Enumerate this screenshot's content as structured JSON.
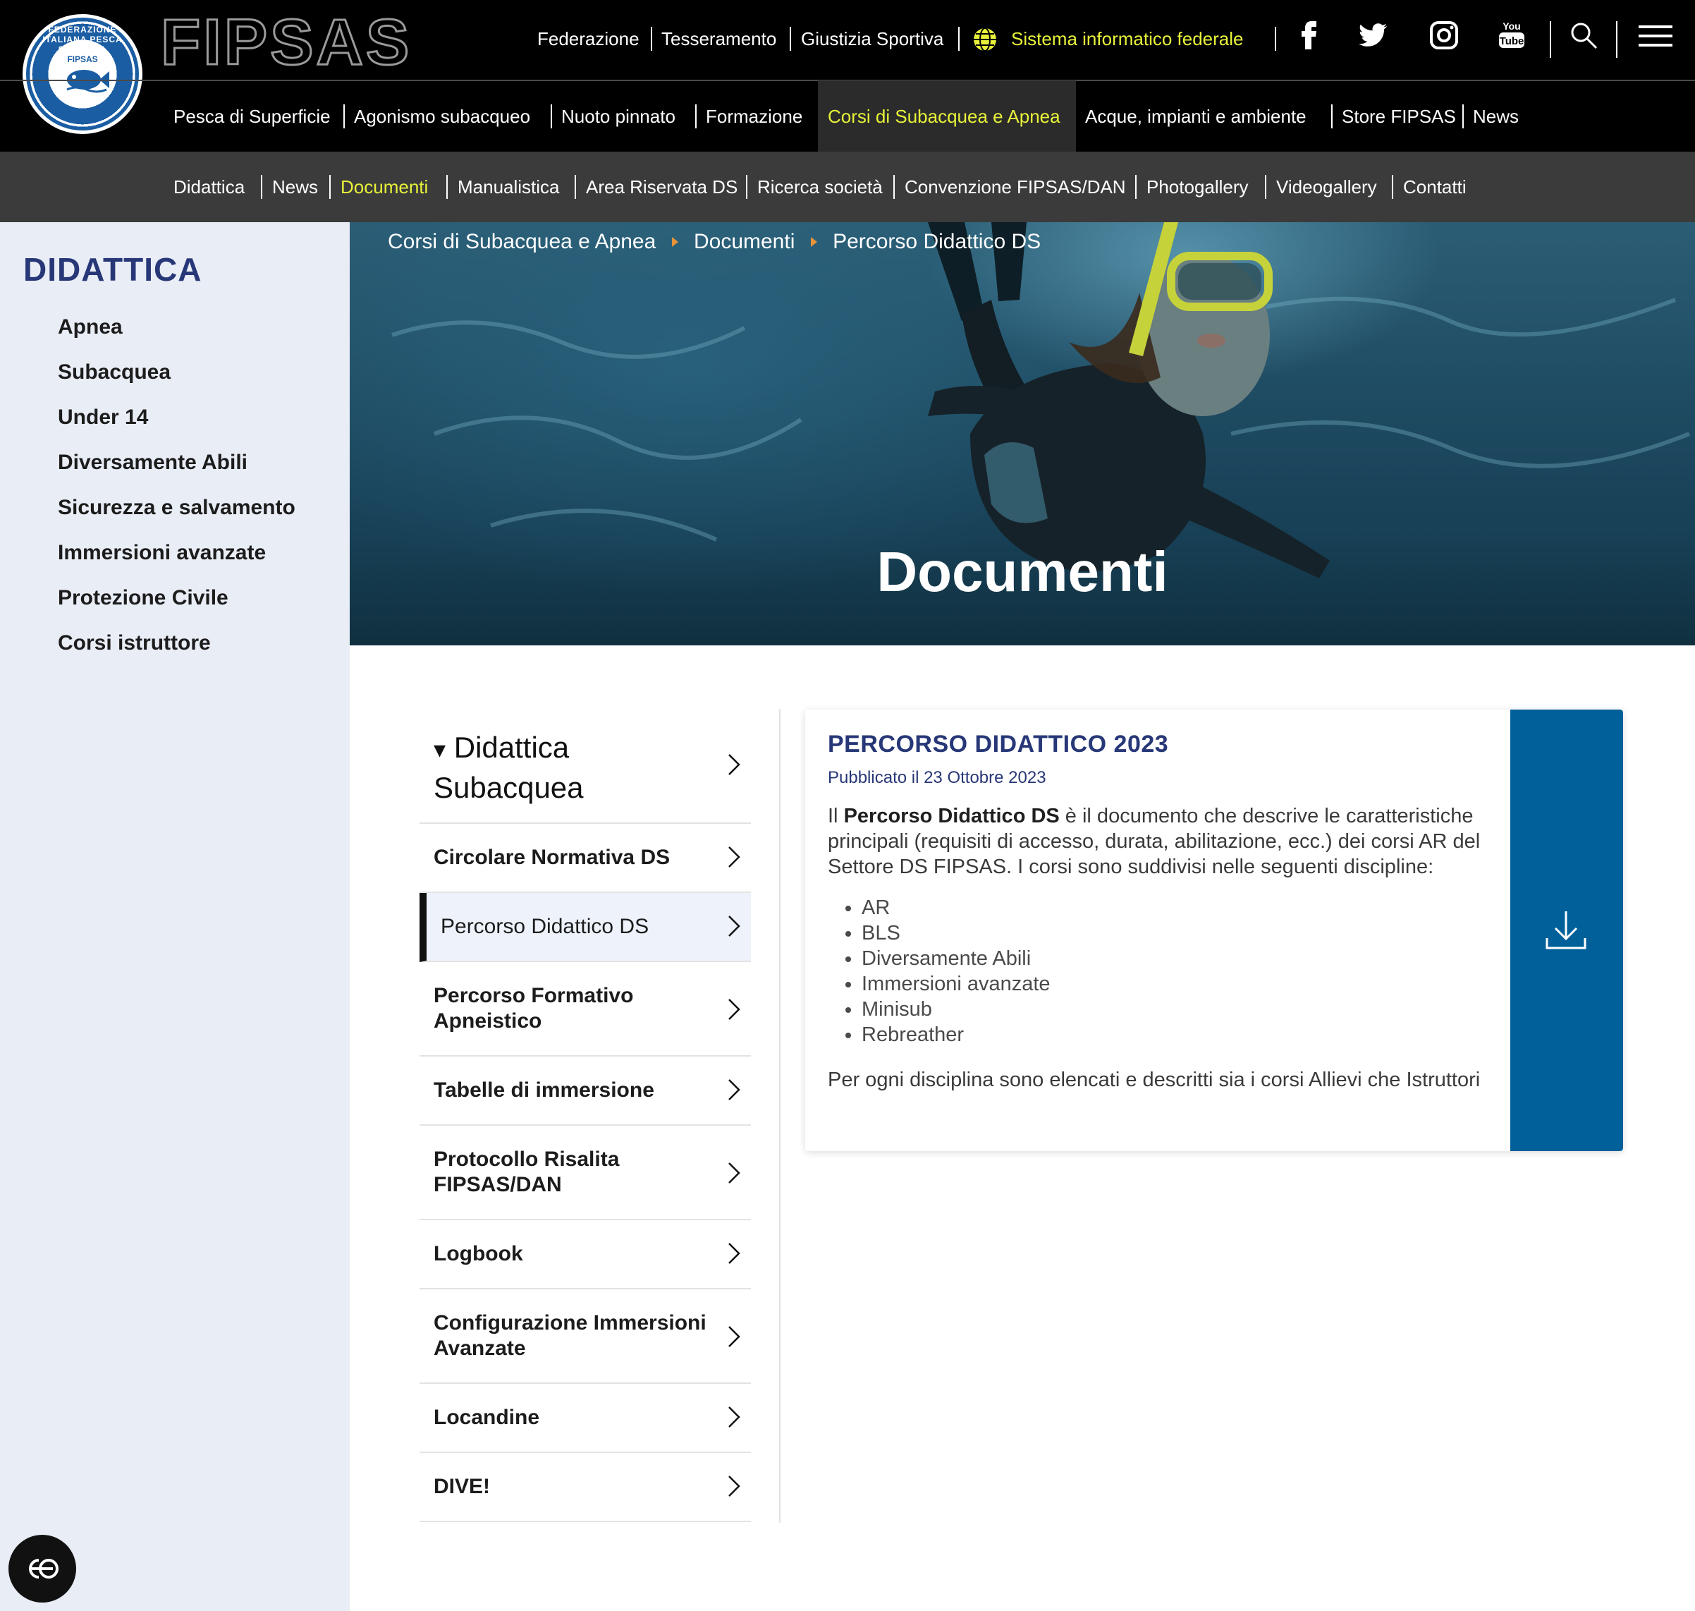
{
  "brand": {
    "wordmark": "FIPSAS",
    "seal_ring_text": "FEDERAZIONE ITALIANA PESCA SPORTIVA",
    "seal_inner_text": "FIPSAS"
  },
  "utility_nav": {
    "items": [
      "Federazione",
      "Tesseramento",
      "Giustizia Sportiva"
    ],
    "system_link": "Sistema informatico federale",
    "social_icons": [
      "facebook-icon",
      "twitter-icon",
      "instagram-icon",
      "youtube-icon"
    ],
    "youtube_label": [
      "You",
      "Tube"
    ]
  },
  "main_nav": {
    "items": [
      "Pesca di Superficie",
      "Agonismo subacqueo",
      "Nuoto pinnato",
      "Formazione",
      "Corsi di Subacquea e Apnea",
      "Acque, impianti e ambiente",
      "Store FIPSAS",
      "News"
    ],
    "active": "Corsi di Subacquea e Apnea"
  },
  "sub_nav": {
    "items": [
      "Didattica",
      "News",
      "Documenti",
      "Manualistica",
      "Area Riservata DS",
      "Ricerca società",
      "Convenzione FIPSAS/DAN",
      "Photogallery",
      "Videogallery",
      "Contatti"
    ],
    "active": "Documenti"
  },
  "sidebar": {
    "title": "DIDATTICA",
    "items": [
      "Apnea",
      "Subacquea",
      "Under 14",
      "Diversamente Abili",
      "Sicurezza e salvamento",
      "Immersioni avanzate",
      "Protezione Civile",
      "Corsi istruttore"
    ]
  },
  "hero": {
    "breadcrumb": [
      "Corsi di Subacquea e Apnea",
      "Documenti",
      "Percorso Didattico DS"
    ],
    "title": "Documenti"
  },
  "doc_list": {
    "heading_marker": "▾",
    "heading_line1": "Didattica",
    "heading_line2": "Subacquea",
    "items": [
      {
        "line1": "Circolare Normativa DS",
        "line2": ""
      },
      {
        "line1": "Percorso Didattico DS",
        "line2": ""
      },
      {
        "line1": "Percorso Formativo",
        "line2": "Apneistico"
      },
      {
        "line1": "Tabelle di immersione",
        "line2": ""
      },
      {
        "line1": "Protocollo Risalita",
        "line2": "FIPSAS/DAN"
      },
      {
        "line1": "Logbook",
        "line2": ""
      },
      {
        "line1": "Configurazione Immersioni",
        "line2": "Avanzate"
      },
      {
        "line1": "Locandine",
        "line2": ""
      },
      {
        "line1": "DIVE!",
        "line2": ""
      }
    ],
    "active": "Percorso Didattico DS"
  },
  "document_card": {
    "title": "PERCORSO DIDATTICO 2023",
    "date": "Pubblicato il 23 Ottobre 2023",
    "desc_prefix": "Il ",
    "desc_bold": "Percorso Didattico DS",
    "desc_suffix": " è il documento che descrive le caratteristiche principali (requisiti di accesso, durata, abilitazione, ecc.) dei corsi AR del Settore DS FIPSAS. I corsi sono suddivisi nelle seguenti discipline:",
    "disciplines": [
      "AR",
      "BLS",
      "Diversamente Abili",
      "Immersioni avanzate",
      "Minisub",
      "Rebreather"
    ],
    "footer": "Per ogni disciplina sono elencati e descritti sia i corsi Allievi che Istruttori",
    "download_icon": "download-icon"
  },
  "colors": {
    "header_bg": "#000000",
    "subnav_bg": "#3b3b3b",
    "accent_yellow": "#e7f23a",
    "sidebar_bg": "#e9edf6",
    "brand_navy": "#273777",
    "download_blue": "#01609a",
    "breadcrumb_arrow": "#e8933a"
  }
}
